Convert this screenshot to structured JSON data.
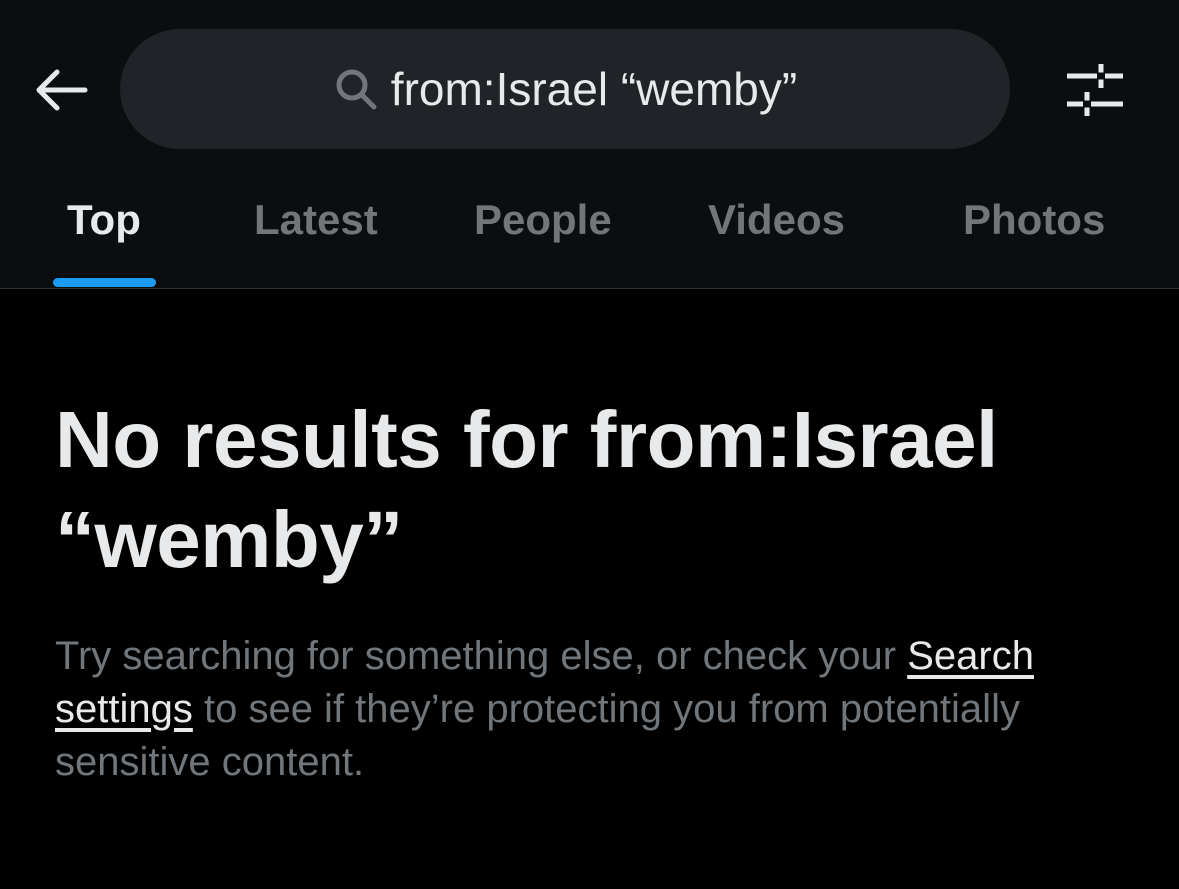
{
  "header": {
    "back_icon": "arrow-left-icon",
    "search": {
      "icon": "search-icon",
      "query": "from:Israel “wemby”"
    },
    "filter_icon": "sliders-icon"
  },
  "tabs": [
    {
      "label": "Top",
      "active": true
    },
    {
      "label": "Latest",
      "active": false
    },
    {
      "label": "People",
      "active": false
    },
    {
      "label": "Videos",
      "active": false
    },
    {
      "label": "Photos",
      "active": false
    }
  ],
  "empty_state": {
    "title": "No results for from:Israel “wemby”",
    "message_before": "Try searching for something else, or check your ",
    "link_label": "Search settings",
    "message_after": " to see if they’re protecting you from potentially sensitive content."
  },
  "colors": {
    "background": "#000000",
    "header_background": "#0c0d0f",
    "search_background": "#202327",
    "text_primary": "#e7e9ea",
    "text_secondary": "#71767b",
    "accent": "#1d9bf0"
  }
}
